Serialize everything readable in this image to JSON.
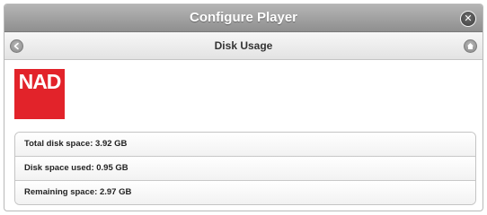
{
  "window": {
    "title": "Configure Player",
    "close_icon": "close-icon"
  },
  "navbar": {
    "title": "Disk Usage",
    "back_icon": "back-icon",
    "home_icon": "home-icon"
  },
  "logo": {
    "text": "NAD",
    "color": "#e2232a"
  },
  "disk": {
    "rows": [
      "Total disk space: 3.92 GB",
      "Disk space used: 0.95 GB",
      "Remaining space: 2.97 GB"
    ]
  }
}
